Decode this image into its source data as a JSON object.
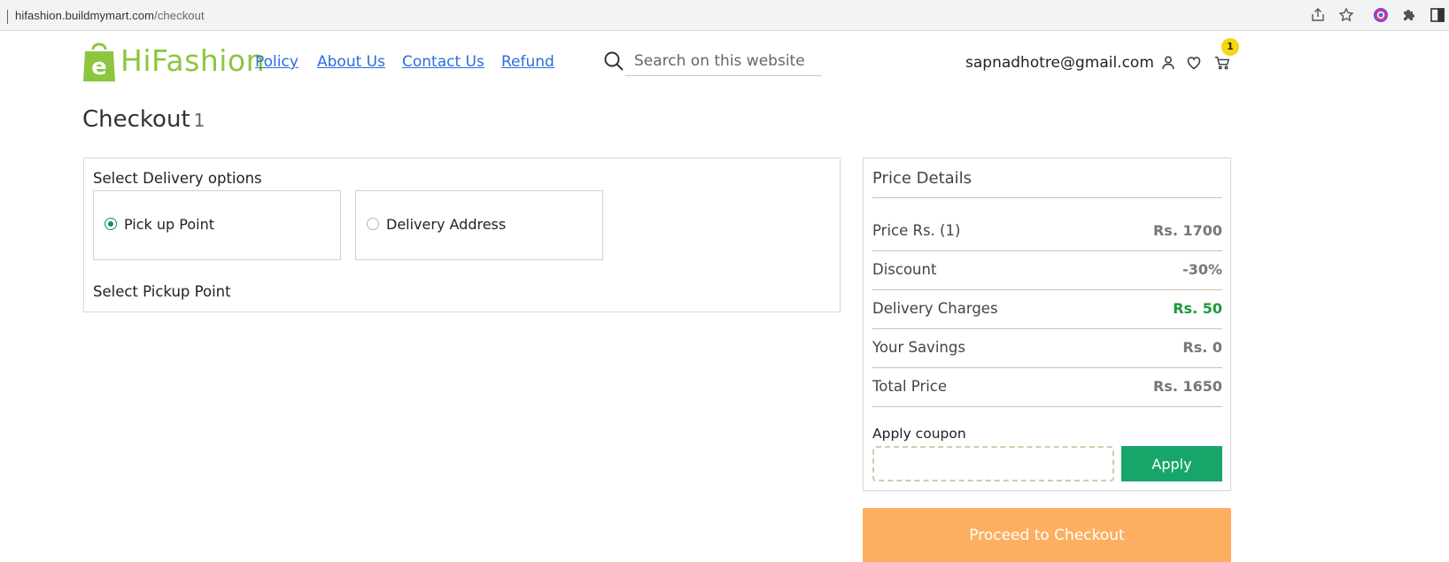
{
  "browser": {
    "url_host": "hifashion.buildmymart.com",
    "url_path": "/checkout",
    "icons": [
      "share-icon",
      "bookmark-star-icon",
      "color-extension-icon",
      "puzzle-extensions-icon",
      "sidebar-icon"
    ]
  },
  "header": {
    "logo_text": "HiFashion",
    "nav": [
      "Policy",
      "About Us",
      "Contact Us",
      "Refund"
    ],
    "search_placeholder": "Search on this website",
    "user_email": "sapnadhotre@gmail.com",
    "cart_count": "1"
  },
  "page": {
    "title": "Checkout",
    "item_count": "1"
  },
  "delivery": {
    "heading": "Select Delivery options",
    "options": [
      {
        "label": "Pick up Point",
        "selected": true
      },
      {
        "label": "Delivery Address",
        "selected": false
      }
    ],
    "pickup_heading": "Select Pickup Point"
  },
  "price_details": {
    "title": "Price Details",
    "rows": [
      {
        "label": "Price Rs. (1)",
        "value": "Rs. 1700"
      },
      {
        "label": "Discount",
        "value": "-30%"
      },
      {
        "label": "Delivery Charges",
        "value": "Rs. 50"
      },
      {
        "label": "Your Savings",
        "value": "Rs. 0"
      },
      {
        "label": "Total Price",
        "value": "Rs. 1650"
      }
    ],
    "coupon_label": "Apply coupon",
    "coupon_value": "",
    "apply_label": "Apply"
  },
  "checkout_button": "Proceed to Checkout",
  "colors": {
    "brand_green": "#8cc63f",
    "link_blue": "#2a6edb",
    "apply_green": "#17a66a",
    "delivery_charge_green": "#1a9a3c",
    "checkout_orange": "#fdae60",
    "badge_yellow": "#f5d60f"
  }
}
